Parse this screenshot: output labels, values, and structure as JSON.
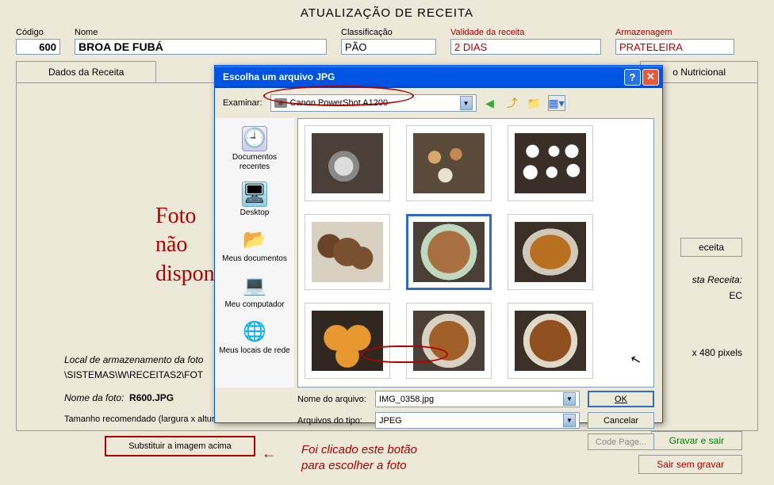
{
  "page": {
    "title": "ATUALIZAÇÃO DE RECEITA"
  },
  "header": {
    "codigo_label": "Código",
    "codigo": "600",
    "nome_label": "Nome",
    "nome": "BROA DE FUBÁ",
    "class_label": "Classificação",
    "class": "PÃO",
    "validade_label": "Validade da receita",
    "validade": "2 DIAS",
    "armazen_label": "Armazenagem",
    "armazen": "PRATELEIRA"
  },
  "tabs": {
    "dados": "Dados da Receita",
    "nutricional": "o Nutricional"
  },
  "foto_nao": "Foto\nnão\ndisponív",
  "storage": {
    "line1_label": "Local de armazenamento da foto",
    "line2": "\\SISTEMAS\\W\\RECEITAS2\\FOT",
    "nome_label": "Nome da foto:",
    "nome": "R600.JPG",
    "tamanho": "Tamanho recomendado (largura x altura"
  },
  "side": {
    "eceita": "eceita",
    "receita_info": "sta Receita:",
    "ec": "EC",
    "pixels": "x 480 pixels"
  },
  "buttons": {
    "substituir": "Substituir a imagem acima",
    "gravar": "Gravar e sair",
    "sair": "Sair sem gravar"
  },
  "annotation": {
    "text": "Foi clicado este botão\npara escolher a foto",
    "arrow": "←"
  },
  "dialog": {
    "title": "Escolha um arquivo JPG",
    "examinar_label": "Examinar:",
    "examinar_value": "Canon PowerShot A1200",
    "places": {
      "recentes": "Documentos recentes",
      "desktop": "Desktop",
      "meusdocs": "Meus documentos",
      "computador": "Meu computador",
      "rede": "Meus locais de rede"
    },
    "filename_label": "Nome do arquivo:",
    "filename": "IMG_0358.jpg",
    "filetype_label": "Arquivos do tipo:",
    "filetype": "JPEG",
    "ok": "OK",
    "cancel": "Cancelar",
    "codepage": "Code Page..."
  }
}
